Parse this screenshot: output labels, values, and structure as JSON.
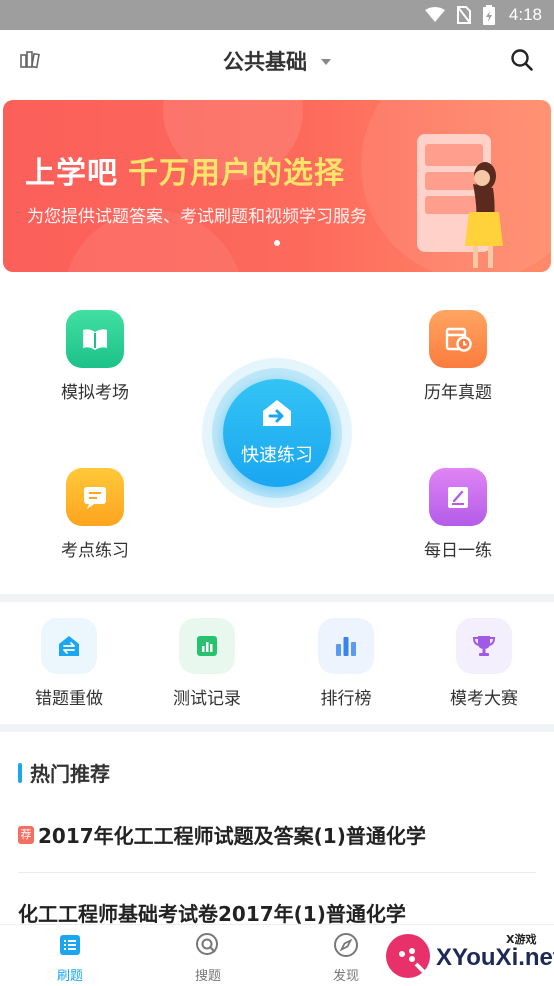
{
  "status_bar": {
    "time": "4:18",
    "icons": [
      "wifi-icon",
      "no-sim-icon",
      "battery-icon"
    ]
  },
  "header": {
    "title": "公共基础",
    "left_icon": "books-icon",
    "right_icon": "search-icon"
  },
  "banner": {
    "headline_part1": "上学吧",
    "headline_part2": "千万用户的选择",
    "subtitle": "为您提供试题答案、考试刷题和视频学习服务"
  },
  "practice": {
    "mock_exam": "模拟考场",
    "past_papers": "历年真题",
    "quick_practice": "快速练习",
    "topic_practice": "考点练习",
    "daily_practice": "每日一练"
  },
  "tools": [
    {
      "label": "错题重做",
      "icon": "redo-icon"
    },
    {
      "label": "测试记录",
      "icon": "record-chart-icon"
    },
    {
      "label": "排行榜",
      "icon": "ranking-bars-icon"
    },
    {
      "label": "模考大赛",
      "icon": "trophy-icon"
    }
  ],
  "hot": {
    "title": "热门推荐",
    "tag": "荐",
    "articles": [
      "2017年化工工程师试题及答案(1)普通化学",
      "化工工程师基础考试卷2017年(1)普通化学"
    ]
  },
  "bottom_nav": [
    {
      "label": "刷题",
      "icon": "list-icon",
      "active": true
    },
    {
      "label": "搜题",
      "icon": "search-question-icon",
      "active": false
    },
    {
      "label": "发现",
      "icon": "compass-icon",
      "active": false
    }
  ],
  "watermark": {
    "brand": "XYouXi.net",
    "small": "X游戏"
  },
  "colors": {
    "accent": "#1ba7f0",
    "banner": "#fb5f5a",
    "highlight": "#ffe46a"
  }
}
